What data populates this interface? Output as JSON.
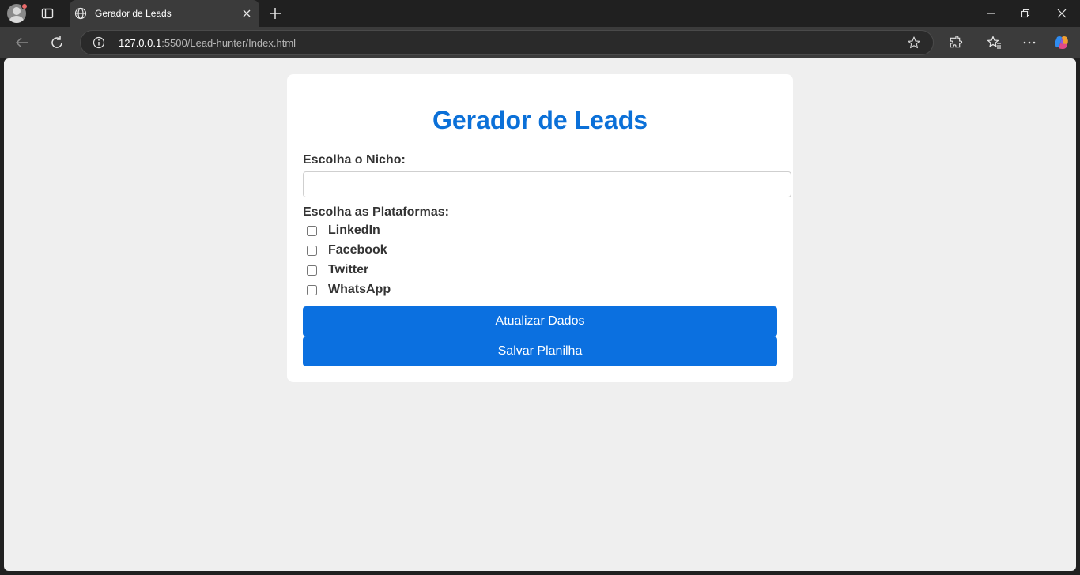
{
  "browser": {
    "tab_title": "Gerador de Leads",
    "url_host": "127.0.0.1",
    "url_rest": ":5500/Lead-hunter/Index.html"
  },
  "page": {
    "title": "Gerador de Leads",
    "niche_label": "Escolha o Nicho:",
    "niche_value": "",
    "platforms_label": "Escolha as Plataformas:",
    "platforms": [
      {
        "label": "LinkedIn",
        "checked": false
      },
      {
        "label": "Facebook",
        "checked": false
      },
      {
        "label": "Twitter",
        "checked": false
      },
      {
        "label": "WhatsApp",
        "checked": false
      }
    ],
    "update_button": "Atualizar Dados",
    "save_button": "Salvar Planilha"
  },
  "colors": {
    "accent": "#0b70e0",
    "title": "#0b70d8",
    "page_bg": "#efefef"
  }
}
